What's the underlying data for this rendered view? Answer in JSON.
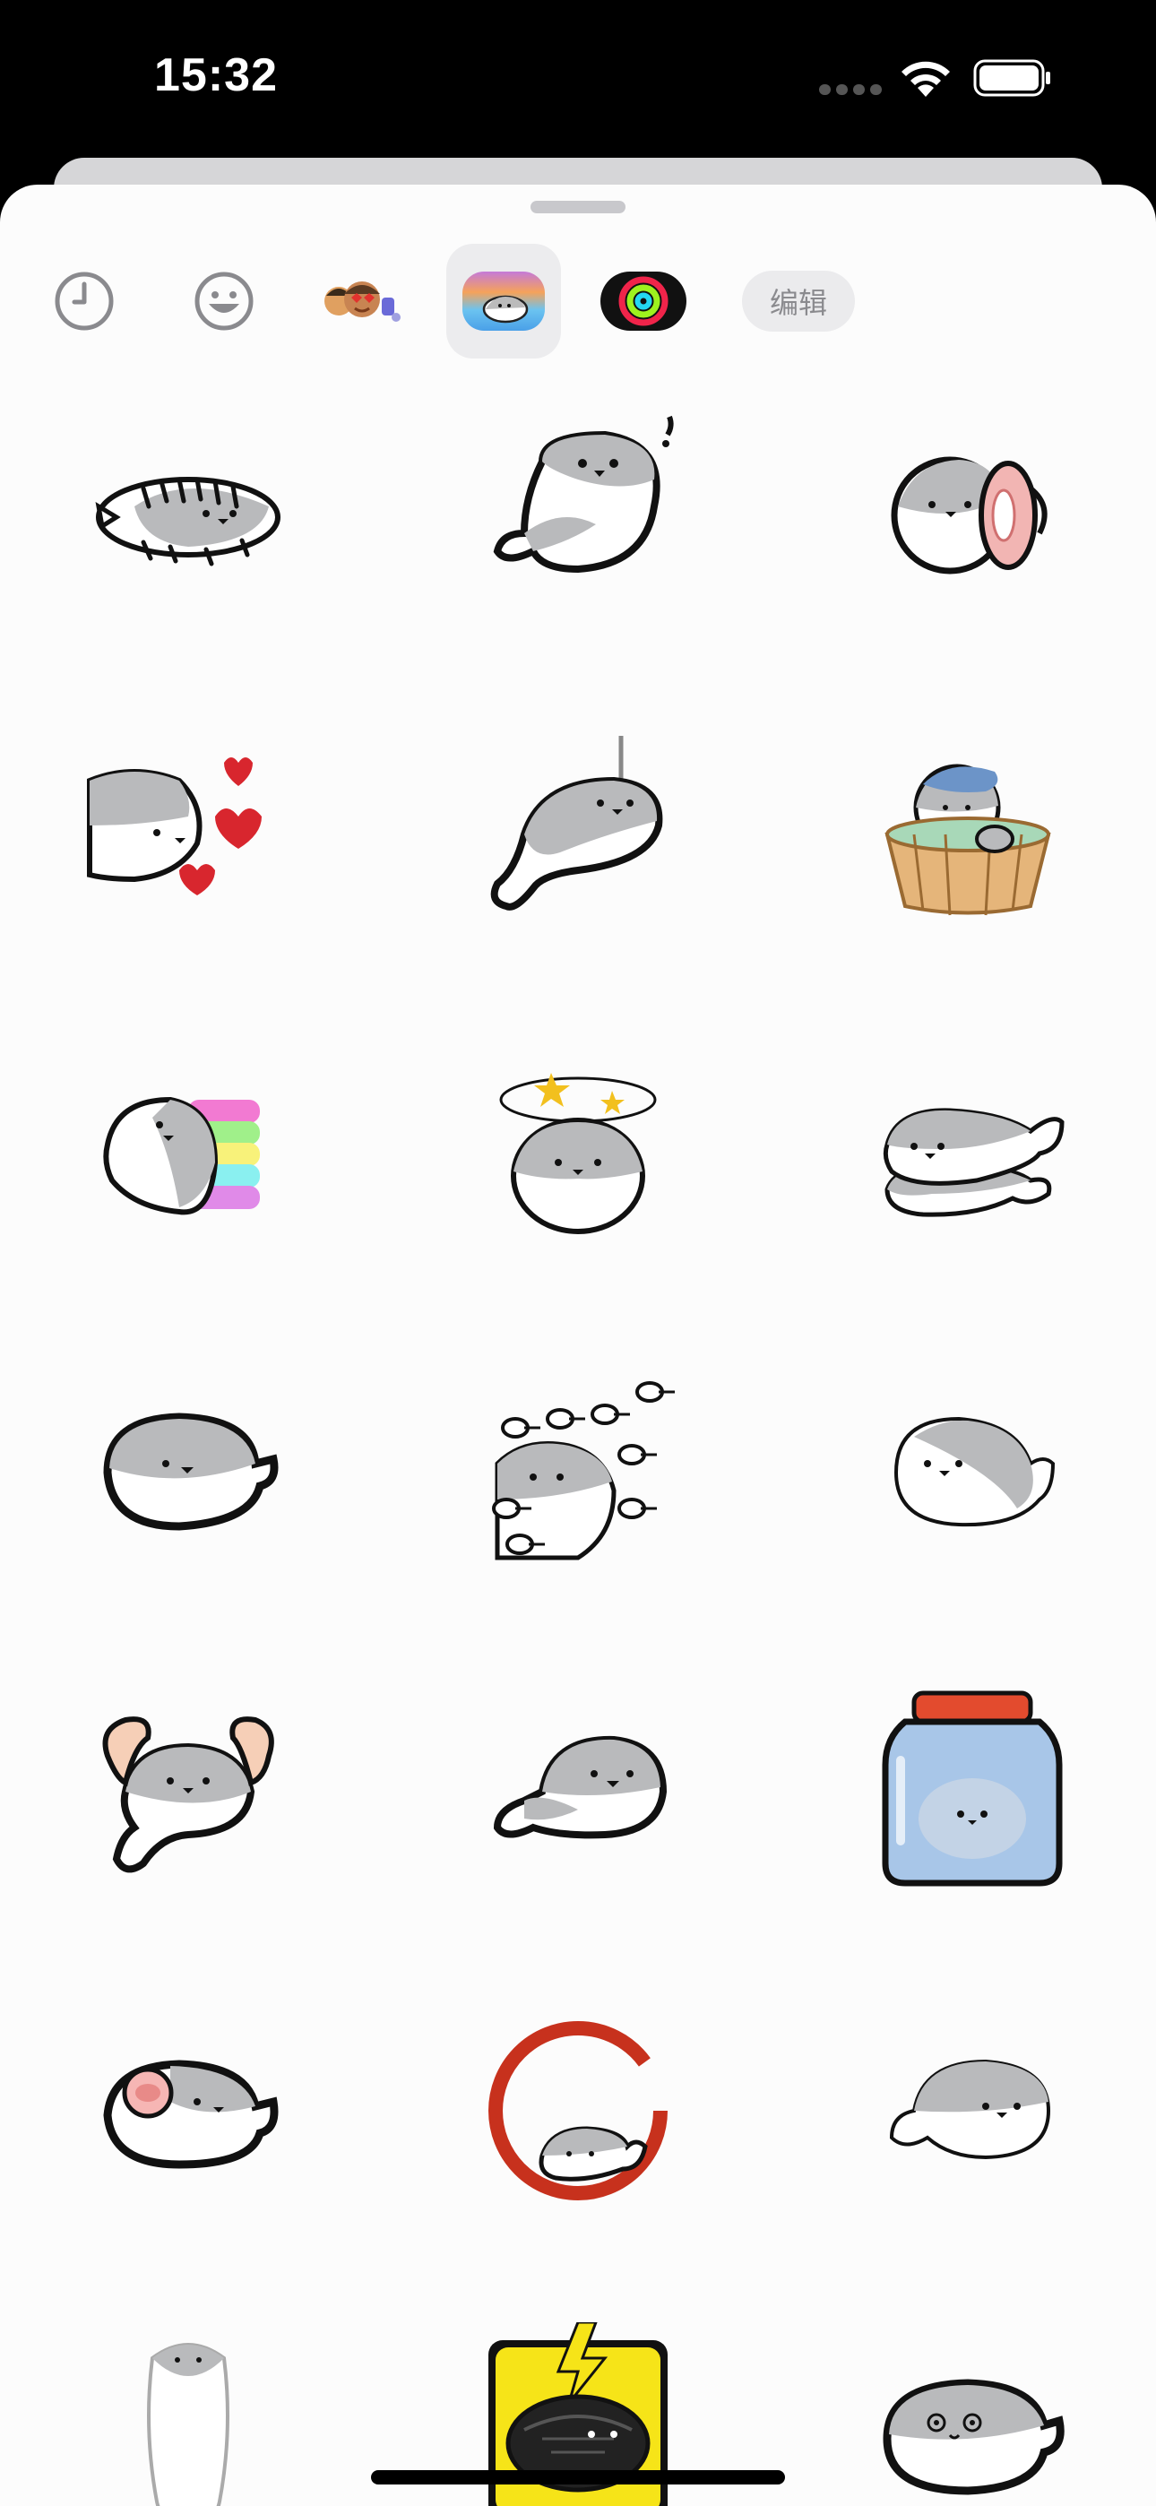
{
  "status_bar": {
    "time": "15:32",
    "icons": [
      "cellular-signal-icon",
      "wifi-icon",
      "battery-icon"
    ]
  },
  "tabs": [
    {
      "name": "recent",
      "icon": "clock-icon",
      "active": false
    },
    {
      "name": "emoji",
      "icon": "smiley-icon",
      "active": false
    },
    {
      "name": "memoji",
      "icon": "memoji-stickers-icon",
      "active": false
    },
    {
      "name": "seal-stickers",
      "icon": "seal-sticker-pack-icon",
      "active": true
    },
    {
      "name": "activity",
      "icon": "activity-rings-icon",
      "active": false
    }
  ],
  "edit_label": "编辑",
  "stickers": [
    {
      "name": "scribble-seal"
    },
    {
      "name": "surprised-seal"
    },
    {
      "name": "ham-seal"
    },
    {
      "name": "hearts-seal"
    },
    {
      "name": "narwhal-seal"
    },
    {
      "name": "bath-tub-seal"
    },
    {
      "name": "rainbow-seal"
    },
    {
      "name": "dizzy-seal"
    },
    {
      "name": "stacked-seals"
    },
    {
      "name": "round-seal"
    },
    {
      "name": "clapping-seal"
    },
    {
      "name": "side-seal"
    },
    {
      "name": "muscle-seal"
    },
    {
      "name": "lying-seal"
    },
    {
      "name": "jar-seal"
    },
    {
      "name": "pig-nose-seal"
    },
    {
      "name": "ink-circle-seal"
    },
    {
      "name": "floating-seal"
    },
    {
      "name": "standing-seal"
    },
    {
      "name": "lightning-seal"
    },
    {
      "name": "smiling-seal"
    }
  ],
  "colors": {
    "sheet_bg": "#fcfcfc",
    "seal_gray": "#b9babc",
    "heart_red": "#d8262e",
    "ink_red": "#c7311d",
    "lightning_yellow": "#f6e418"
  }
}
